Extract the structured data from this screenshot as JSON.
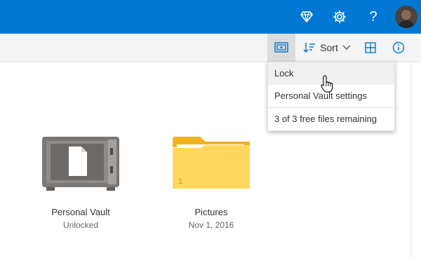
{
  "header": {
    "icons": [
      "premium-diamond-icon",
      "settings-gear-icon",
      "help-question-icon",
      "user-avatar"
    ],
    "help_glyph": "?"
  },
  "command_bar": {
    "vault_icon": "personal-vault-icon",
    "sort_label": "Sort",
    "sort_icon": "sort-icon",
    "view_icon": "grid-view-icon",
    "info_icon": "info-icon"
  },
  "vault_menu": {
    "items": [
      {
        "label": "Lock"
      },
      {
        "label": "Personal Vault settings"
      },
      {
        "label": "3 of 3 free files remaining"
      }
    ]
  },
  "files": [
    {
      "name": "Personal Vault",
      "subtitle": "Unlocked",
      "icon": "vault-safe-icon"
    },
    {
      "name": "Pictures",
      "subtitle": "Nov 1, 2016",
      "icon": "folder-icon",
      "badge": "1"
    }
  ],
  "colors": {
    "brand": "#0078d4",
    "folder": "#ffd75e",
    "folder_tab": "#f2b21b",
    "vault": "#7a7775"
  }
}
